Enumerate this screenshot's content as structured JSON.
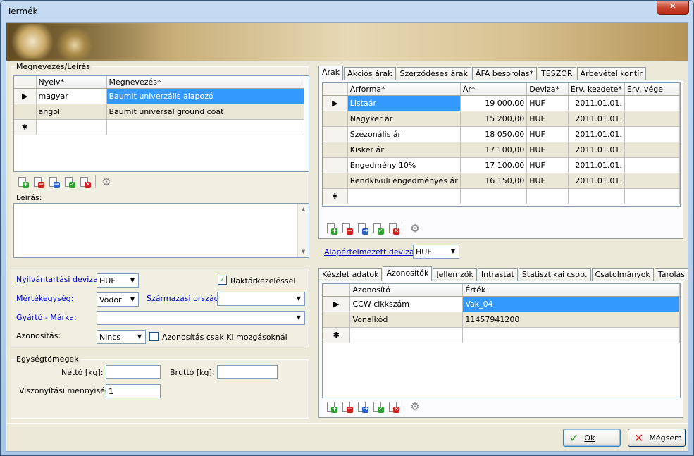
{
  "window": {
    "title": "Termék",
    "close_glyph": "✕"
  },
  "names_group": {
    "label": "Megnevezés/Leírás",
    "headers": [
      "Nyelv*",
      "Megnevezés*"
    ],
    "rows": [
      {
        "lang": "magyar",
        "name": "Baumit univerzális alapozó"
      },
      {
        "lang": "angol",
        "name": "Baumit universal ground coat"
      }
    ],
    "new_row_marker": "✱",
    "current_row_marker": "▶"
  },
  "description": {
    "label": "Leírás:"
  },
  "stock": {
    "currency_label": "Nyilvántartási deviza:*",
    "currency_value": "HUF",
    "inventory_label": "Raktárkezeléssel",
    "inventory_checked": true,
    "unit_label": "Mértékegység:",
    "unit_value": "Vödör",
    "origin_label": "Származási ország:",
    "origin_value": "",
    "maker_label": "Gyártó - Márka:",
    "maker_value": "",
    "ident_label": "Azonosítás:",
    "ident_value": "Nincs",
    "ident_only_out_label": "Azonosítás csak KI mozgásoknál",
    "ident_only_out_checked": false
  },
  "units": {
    "label": "Egységtömegek",
    "net_label": "Nettó [kg]:",
    "net_value": "",
    "gross_label": "Bruttó [kg]:",
    "gross_value": "",
    "ratio_label": "Viszonyítási mennyiség:",
    "ratio_value": "1"
  },
  "price_tabs": [
    "Árak",
    "Akciós árak",
    "Szerződéses árak",
    "ÁFA besorolás*",
    "TESZOR",
    "Árbevétel kontír"
  ],
  "prices": {
    "headers": [
      "Árforma*",
      "Ár*",
      "Deviza*",
      "Érv. kezdete*",
      "Érv. vége"
    ],
    "rows": [
      {
        "form": "Listaár",
        "price": "19 000,00",
        "cur": "HUF",
        "start": "2011.01.01.",
        "end": ""
      },
      {
        "form": "Nagyker ár",
        "price": "15 200,00",
        "cur": "HUF",
        "start": "2011.01.01.",
        "end": ""
      },
      {
        "form": "Szezonális ár",
        "price": "18 050,00",
        "cur": "HUF",
        "start": "2011.01.01.",
        "end": ""
      },
      {
        "form": "Kisker ár",
        "price": "17 100,00",
        "cur": "HUF",
        "start": "2011.01.01.",
        "end": ""
      },
      {
        "form": "Engedmény 10%",
        "price": "17 100,00",
        "cur": "HUF",
        "start": "2011.01.01.",
        "end": ""
      },
      {
        "form": "Rendkívüli engedményes ár",
        "price": "16 150,00",
        "cur": "HUF",
        "start": "2011.01.01.",
        "end": ""
      }
    ]
  },
  "default_currency": {
    "label": "Alapértelmezett deviza:",
    "value": "HUF"
  },
  "id_tabs": [
    "Készlet adatok",
    "Azonosítók",
    "Jellemzők",
    "Intrastat",
    "Statisztikai csop.",
    "Csatolmányok",
    "Tárolás"
  ],
  "ids": {
    "headers": [
      "Azonosító",
      "Érték"
    ],
    "rows": [
      {
        "id": "CCW cikkszám",
        "value": "Vak_04"
      },
      {
        "id": "Vonalkód",
        "value": "11457941200"
      }
    ]
  },
  "buttons": {
    "ok": "Ok",
    "cancel": "Mégsem"
  },
  "colors": {
    "selection": "#3399ff",
    "link": "#0000cc",
    "title_close": "#c8472f"
  }
}
